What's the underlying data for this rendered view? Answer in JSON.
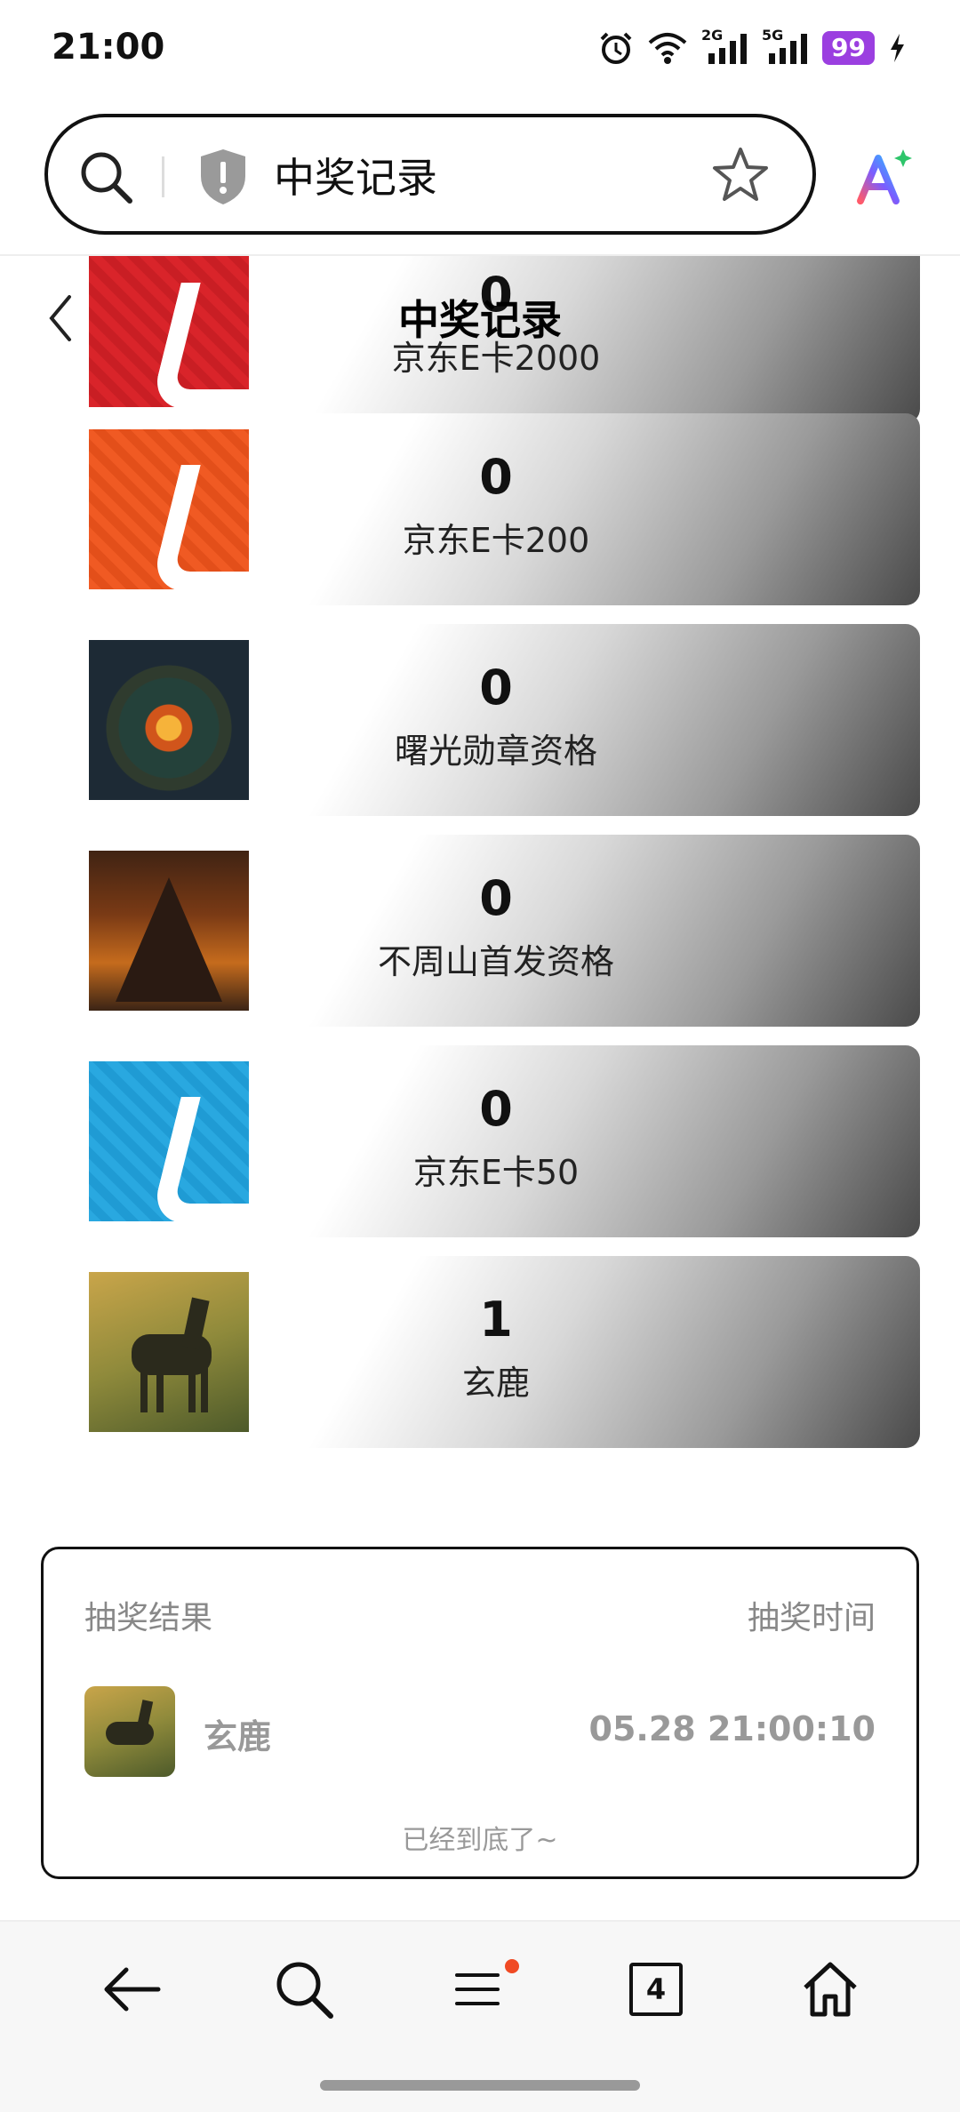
{
  "status": {
    "time": "21:00",
    "net1": "2G",
    "net2": "5G",
    "battery": "99"
  },
  "address_bar": {
    "query": "中奖记录"
  },
  "page": {
    "title": "中奖记录"
  },
  "prizes": [
    {
      "count": "0",
      "name": "京东E卡2000",
      "thumb": "jd-red"
    },
    {
      "count": "0",
      "name": "京东E卡200",
      "thumb": "jd-orange"
    },
    {
      "count": "0",
      "name": "曙光勋章资格",
      "thumb": "medal"
    },
    {
      "count": "0",
      "name": "不周山首发资格",
      "thumb": "mountain"
    },
    {
      "count": "0",
      "name": "京东E卡50",
      "thumb": "jd-blue"
    },
    {
      "count": "1",
      "name": "玄鹿",
      "thumb": "deer"
    }
  ],
  "results": {
    "header_left": "抽奖结果",
    "header_right": "抽奖时间",
    "items": [
      {
        "name": "玄鹿",
        "time": "05.28 21:00:10"
      }
    ],
    "end_text": "已经到底了~"
  },
  "bottom_nav": {
    "tab_count": "4"
  },
  "colors": {
    "battery": "#9b3fe0",
    "notification_dot": "#f04a24"
  }
}
